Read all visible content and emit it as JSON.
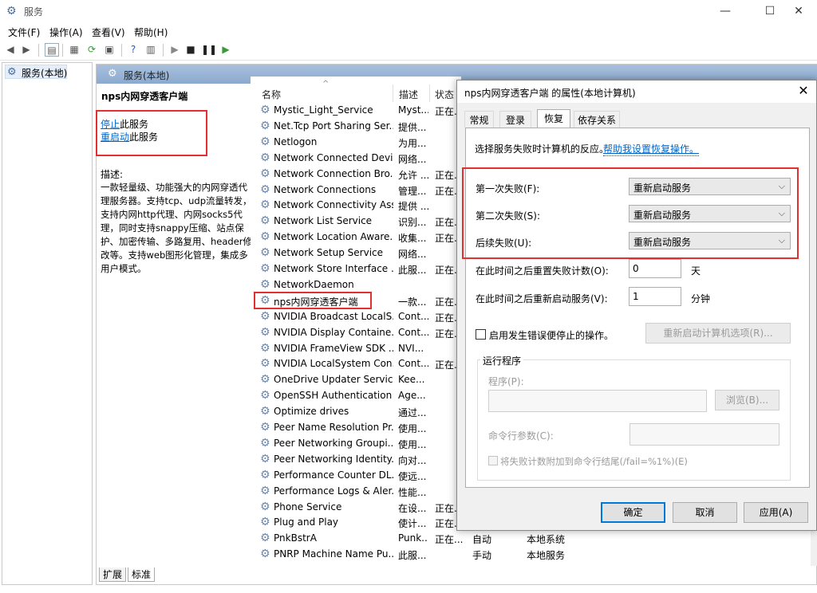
{
  "window": {
    "title": "服务",
    "minimize": "—",
    "maximize": "☐",
    "close": "✕"
  },
  "menu": [
    "文件(F)",
    "操作(A)",
    "查看(V)",
    "帮助(H)"
  ],
  "tree": {
    "label": "服务(本地)"
  },
  "header": {
    "label": "服务(本地)"
  },
  "desc_panel": {
    "service_name": "nps内网穿透客户端",
    "stop_link": "停止",
    "stop_rest": "此服务",
    "restart_link": "重启动",
    "restart_rest": "此服务",
    "desc_label": "描述:",
    "desc_text": "一款轻量级、功能强大的内网穿透代理服务器。支持tcp、udp流量转发，支持内网http代理、内网socks5代理，同时支持snappy压缩、站点保护、加密传输、多路复用、header修改等。支持web图形化管理，集成多用户模式。"
  },
  "columns": {
    "name": "名称",
    "desc": "描述",
    "status": "状态"
  },
  "rows": [
    {
      "name": "Mystic_Light_Service",
      "desc": "Myst...",
      "status": "正在...",
      "startup": "",
      "logon": ""
    },
    {
      "name": "Net.Tcp Port Sharing Ser...",
      "desc": "提供...",
      "status": "",
      "startup": "",
      "logon": ""
    },
    {
      "name": "Netlogon",
      "desc": "为用...",
      "status": "",
      "startup": "",
      "logon": ""
    },
    {
      "name": "Network Connected Devi...",
      "desc": "网络...",
      "status": "",
      "startup": "",
      "logon": ""
    },
    {
      "name": "Network Connection Bro...",
      "desc": "允许 ...",
      "status": "正在...",
      "startup": "",
      "logon": ""
    },
    {
      "name": "Network Connections",
      "desc": "管理...",
      "status": "正在...",
      "startup": "",
      "logon": ""
    },
    {
      "name": "Network Connectivity Ass...",
      "desc": "提供 ...",
      "status": "",
      "startup": "",
      "logon": ""
    },
    {
      "name": "Network List Service",
      "desc": "识别...",
      "status": "正在...",
      "startup": "",
      "logon": ""
    },
    {
      "name": "Network Location Aware...",
      "desc": "收集...",
      "status": "正在...",
      "startup": "",
      "logon": ""
    },
    {
      "name": "Network Setup Service",
      "desc": "网络...",
      "status": "",
      "startup": "",
      "logon": ""
    },
    {
      "name": "Network Store Interface ...",
      "desc": "此服...",
      "status": "正在...",
      "startup": "",
      "logon": ""
    },
    {
      "name": "NetworkDaemon",
      "desc": "",
      "status": "",
      "startup": "",
      "logon": ""
    },
    {
      "name": "nps内网穿透客户端",
      "desc": "一款...",
      "status": "正在...",
      "startup": "",
      "logon": ""
    },
    {
      "name": "NVIDIA Broadcast LocalS...",
      "desc": "Cont...",
      "status": "正在...",
      "startup": "",
      "logon": ""
    },
    {
      "name": "NVIDIA Display Containe...",
      "desc": "Cont...",
      "status": "正在...",
      "startup": "",
      "logon": ""
    },
    {
      "name": "NVIDIA FrameView SDK ...",
      "desc": "NVI...",
      "status": "",
      "startup": "",
      "logon": ""
    },
    {
      "name": "NVIDIA LocalSystem Con...",
      "desc": "Cont...",
      "status": "正在...",
      "startup": "",
      "logon": ""
    },
    {
      "name": "OneDrive Updater Service",
      "desc": "Kee...",
      "status": "",
      "startup": "",
      "logon": ""
    },
    {
      "name": "OpenSSH Authentication ...",
      "desc": "Age...",
      "status": "",
      "startup": "",
      "logon": ""
    },
    {
      "name": "Optimize drives",
      "desc": "通过...",
      "status": "",
      "startup": "",
      "logon": ""
    },
    {
      "name": "Peer Name Resolution Pr...",
      "desc": "使用...",
      "status": "",
      "startup": "",
      "logon": ""
    },
    {
      "name": "Peer Networking Groupi...",
      "desc": "使用...",
      "status": "",
      "startup": "",
      "logon": ""
    },
    {
      "name": "Peer Networking Identity...",
      "desc": "向对...",
      "status": "",
      "startup": "",
      "logon": ""
    },
    {
      "name": "Performance Counter DL...",
      "desc": "使远...",
      "status": "",
      "startup": "",
      "logon": ""
    },
    {
      "name": "Performance Logs & Aler...",
      "desc": "性能...",
      "status": "",
      "startup": "",
      "logon": ""
    },
    {
      "name": "Phone Service",
      "desc": "在设...",
      "status": "正在...",
      "startup": "",
      "logon": ""
    },
    {
      "name": "Plug and Play",
      "desc": "使计...",
      "status": "正在...",
      "startup": "",
      "logon": ""
    },
    {
      "name": "PnkBstrA",
      "desc": "Punk...",
      "status": "正在...",
      "startup": "自动",
      "logon": "本地系统"
    },
    {
      "name": "PNRP Machine Name Pu...",
      "desc": "此服...",
      "status": "",
      "startup": "手动",
      "logon": "本地服务"
    }
  ],
  "bottom_tabs": [
    "扩展",
    "标准"
  ],
  "dialog": {
    "title": "nps内网穿透客户端 的属性(本地计算机)",
    "tabs": [
      "常规",
      "登录",
      "恢复",
      "依存关系"
    ],
    "intro": "选择服务失败时计算机的反应。",
    "help_link": "帮助我设置恢复操作。",
    "first_label": "第一次失败(F):",
    "first_value": "重新启动服务",
    "second_label": "第二次失败(S):",
    "second_value": "重新启动服务",
    "subsequent_label": "后续失败(U):",
    "subsequent_value": "重新启动服务",
    "reset_label": "在此时间之后重置失败计数(O):",
    "reset_value": "0",
    "reset_unit": "天",
    "restart_after_label": "在此时间之后重新启动服务(V):",
    "restart_after_value": "1",
    "restart_after_unit": "分钟",
    "enable_actions_label": "启用发生错误便停止的操作。",
    "restart_computer_btn": "重新启动计算机选项(R)...",
    "run_program_group": "运行程序",
    "program_label": "程序(P):",
    "browse_btn": "浏览(B)...",
    "params_label": "命令行参数(C):",
    "append_label": "将失败计数附加到命令行结尾(/fail=%1%)(E)",
    "ok": "确定",
    "cancel": "取消",
    "apply": "应用(A)"
  }
}
